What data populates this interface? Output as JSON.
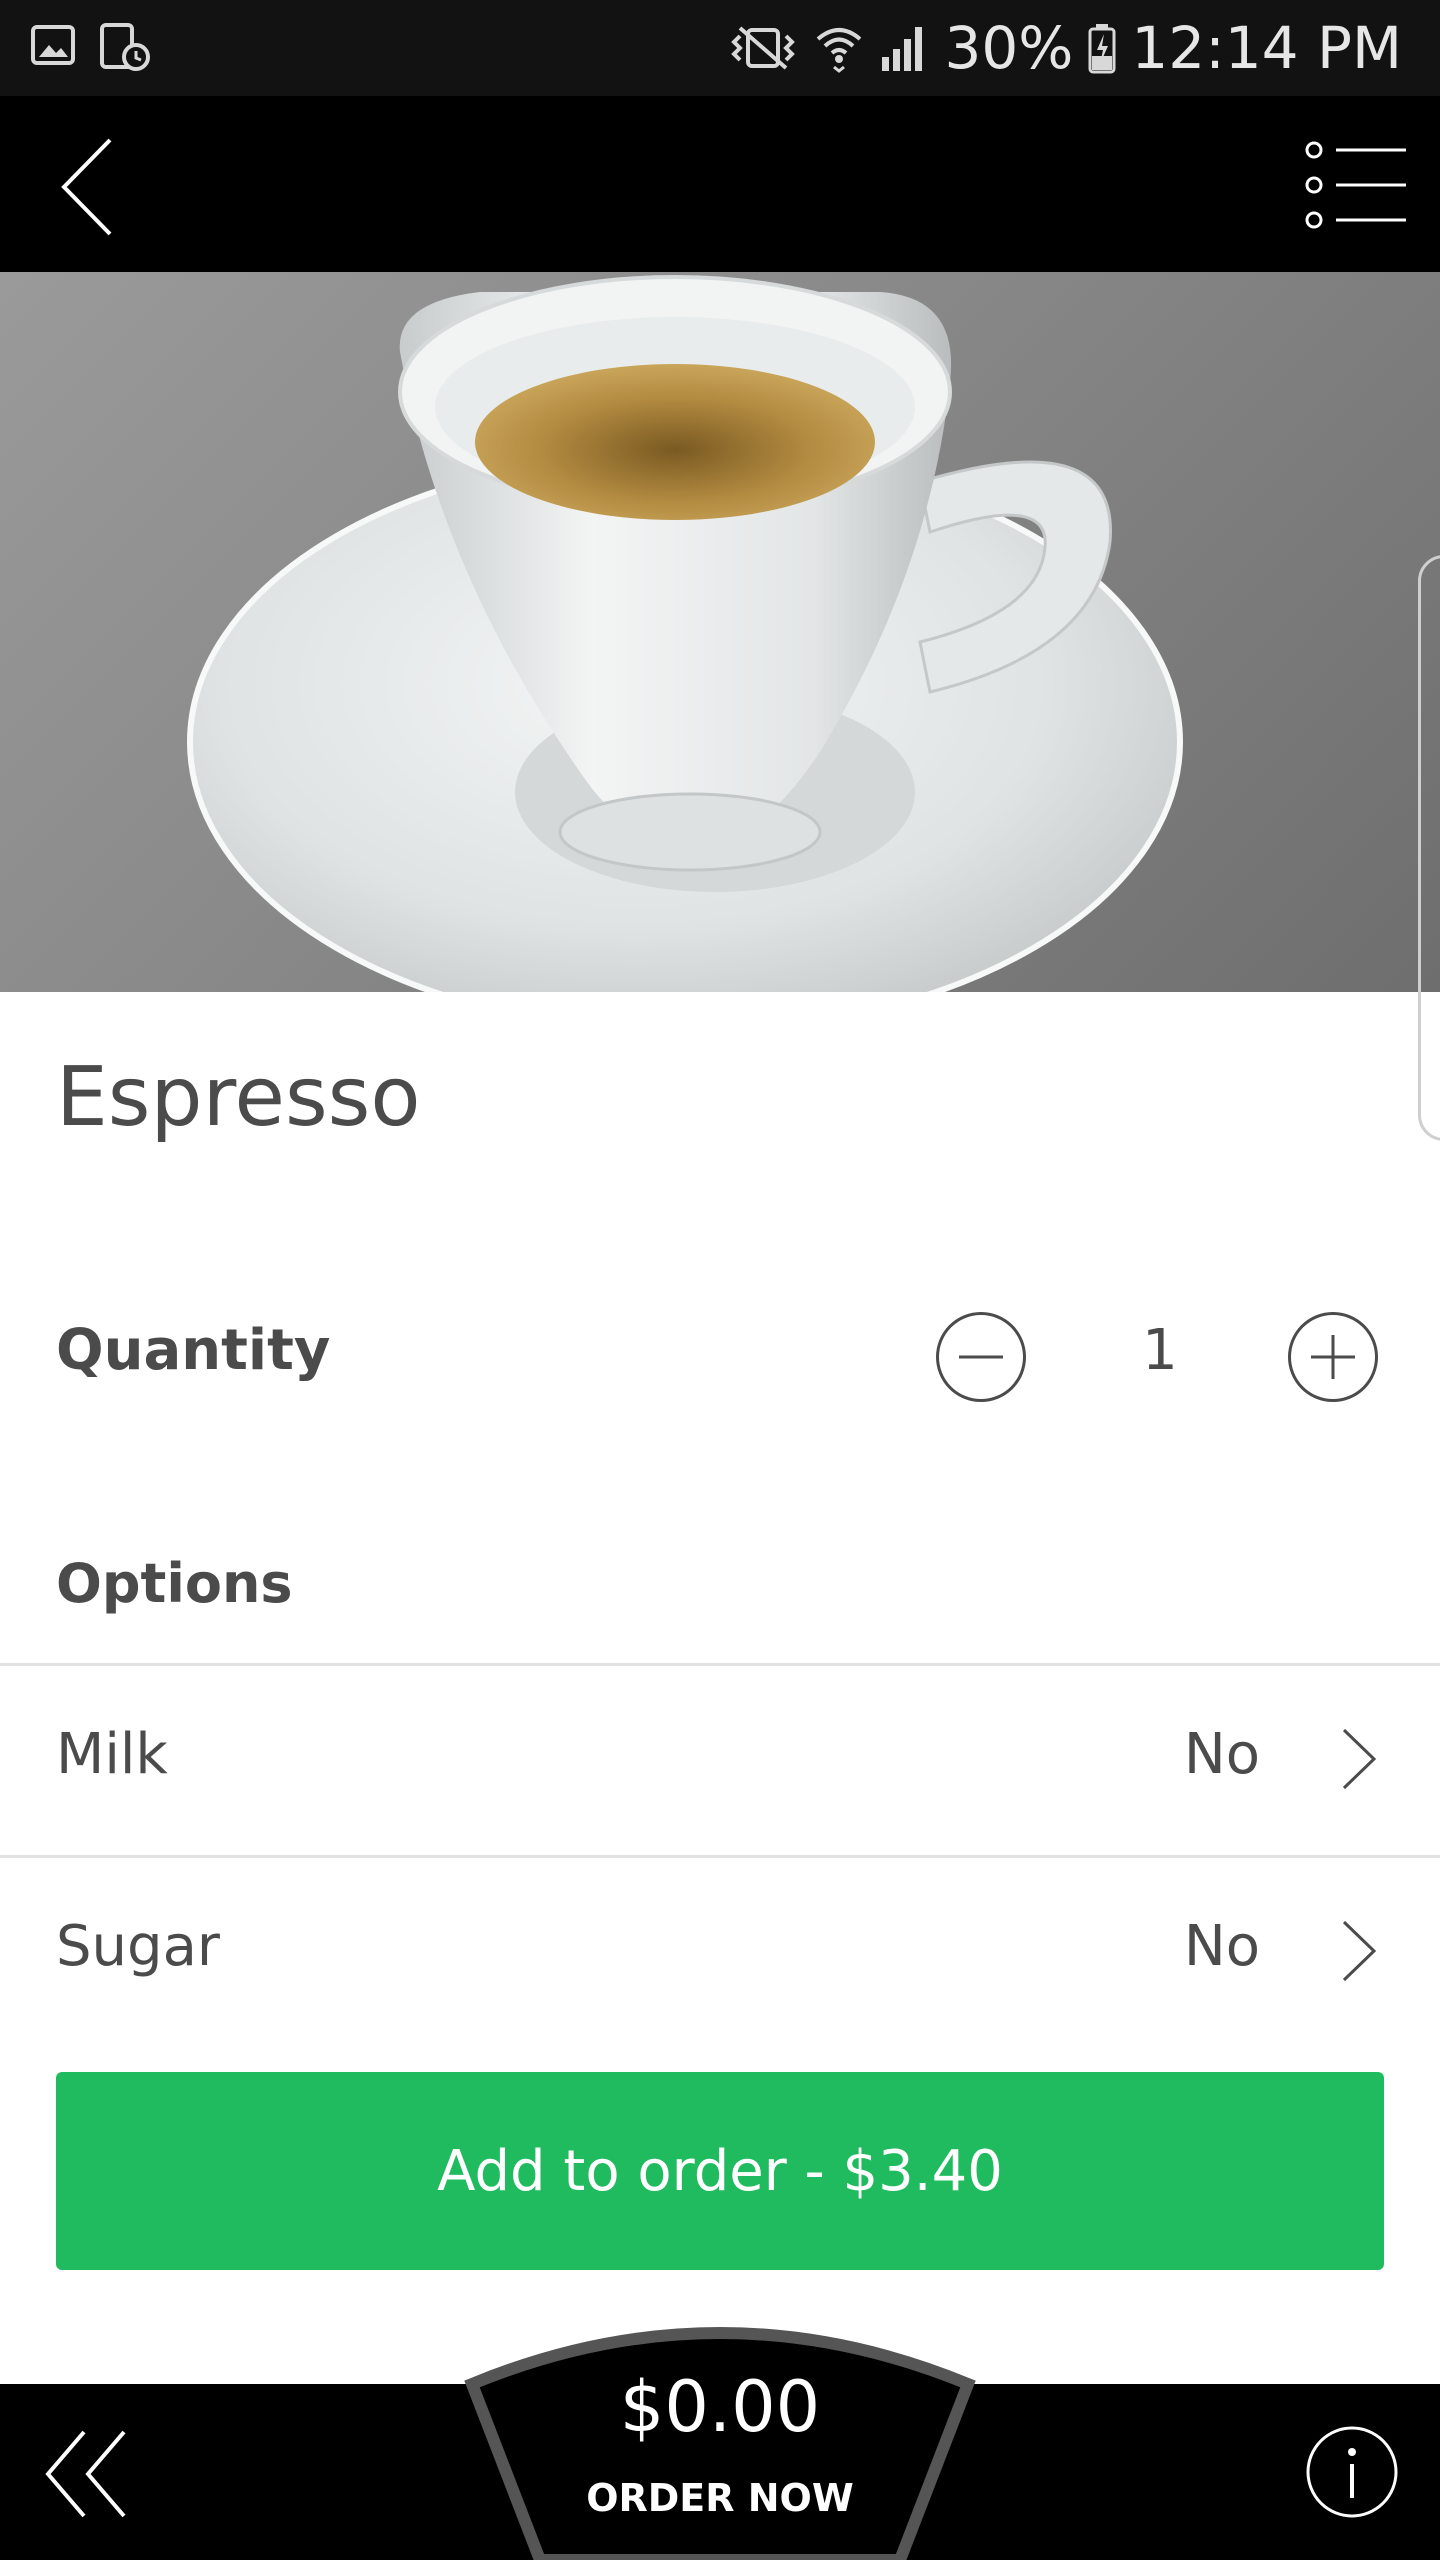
{
  "status_bar": {
    "battery": "30%",
    "time": "12:14 PM",
    "icons": [
      "gallery-icon",
      "screen-time-icon",
      "vibrate-icon",
      "wifi-icon",
      "signal-icon",
      "battery-icon"
    ]
  },
  "header": {
    "back_icon": "back-arrow-icon",
    "menu_icon": "list-menu-icon"
  },
  "product": {
    "title": "Espresso",
    "image": "espresso-cup-photo"
  },
  "quantity": {
    "label": "Quantity",
    "value": "1"
  },
  "options": {
    "heading": "Options",
    "items": [
      {
        "label": "Milk",
        "value": "No"
      },
      {
        "label": "Sugar",
        "value": "No"
      }
    ]
  },
  "add_button": {
    "label": "Add to order - $3.40"
  },
  "bottom_bar": {
    "total": "$0.00",
    "order_now": "ORDER NOW",
    "back_icon": "double-chevron-left-icon",
    "info_icon": "info-icon"
  },
  "colors": {
    "accent_green": "#1fbb5e",
    "header_bg": "#000000",
    "text": "#4b4b4b"
  }
}
